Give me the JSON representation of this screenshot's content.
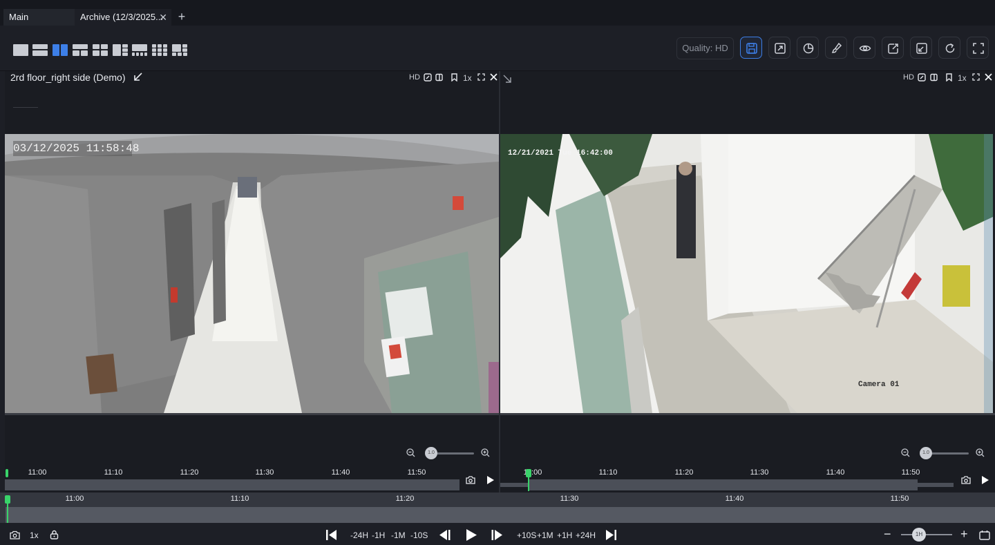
{
  "tabs": {
    "main_label": "Main",
    "archive_label": "Archive (12/3/2025...",
    "close_glyph": "✕",
    "add_glyph": "+"
  },
  "toolbar": {
    "quality_label": "Quality: HD",
    "active_layout_index": 2,
    "accent_color": "#3d7fe8",
    "buttons": [
      "save-icon",
      "external-link-icon",
      "pie-chart-icon",
      "brush-icon",
      "eye-icon",
      "share-icon",
      "resize-icon",
      "refresh-icon",
      "fullscreen-icon"
    ]
  },
  "left_pane": {
    "title": "2rd floor_right side (Demo)",
    "quality_badge": "HD",
    "speed": "1x",
    "osd_timestamp": "03/12/2025  11:58:48",
    "zoom_value": "1.0",
    "timeline_ticks": [
      "11:00",
      "11:10",
      "11:20",
      "11:30",
      "11:40",
      "11:50"
    ]
  },
  "right_pane": {
    "quality_badge": "HD",
    "speed": "1x",
    "osd_timestamp": "12/21/2021 Tue 16:42:00",
    "osd_camera": "Camera 01",
    "zoom_value": "1.0",
    "timeline_ticks": [
      "11:00",
      "11:10",
      "11:20",
      "11:30",
      "11:40",
      "11:50"
    ]
  },
  "main_timeline": {
    "ticks": [
      "11:00",
      "11:10",
      "11:20",
      "11:30",
      "11:40",
      "11:50"
    ]
  },
  "bottom": {
    "speed": "1x",
    "seek_back": [
      "-24H",
      "-1H",
      "-1M",
      "-10S"
    ],
    "seek_forward": [
      "+10S",
      "+1M",
      "+1H",
      "+24H"
    ],
    "scale_label": "1H",
    "zoom_out_glyph": "−",
    "zoom_in_glyph": "+"
  }
}
